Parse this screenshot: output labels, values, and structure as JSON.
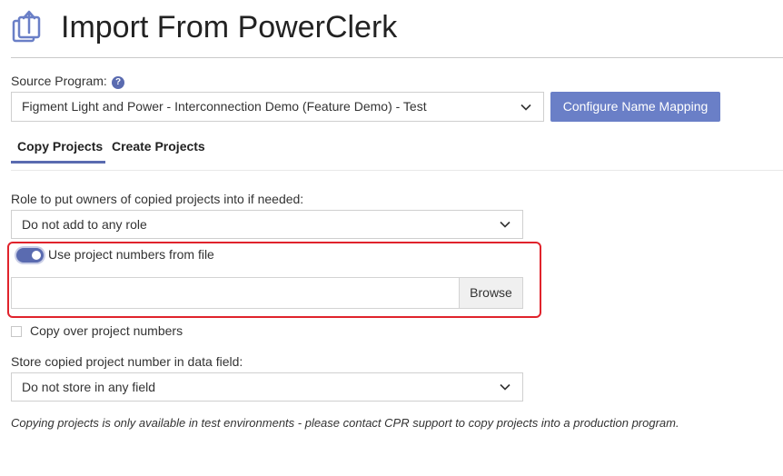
{
  "header": {
    "title": "Import From PowerClerk",
    "icon": "import-upload-icon"
  },
  "source_program": {
    "label": "Source Program:",
    "help_icon": "question-icon",
    "help_glyph": "?",
    "selected": "Figment Light and Power - Interconnection Demo (Feature Demo) - Test"
  },
  "configure_button": {
    "label": "Configure Name Mapping"
  },
  "tabs": [
    {
      "label": "Copy Projects",
      "active": true
    },
    {
      "label": "Create Projects",
      "active": false
    }
  ],
  "role_field": {
    "label": "Role to put owners of copied projects into if needed:",
    "selected": "Do not add to any role"
  },
  "use_numbers_toggle": {
    "label": "Use project numbers from file",
    "on": true
  },
  "file_input": {
    "value": "",
    "browse_label": "Browse"
  },
  "copy_numbers_checkbox": {
    "label": "Copy over project numbers",
    "checked": false
  },
  "store_field": {
    "label": "Store copied project number in data field:",
    "selected": "Do not store in any field"
  },
  "note": "Copying projects is only available in test environments - please contact CPR support to copy projects into a production program.",
  "colors": {
    "accent": "#5a6bb0",
    "button": "#6a7fc7",
    "highlight": "#e0232c"
  }
}
